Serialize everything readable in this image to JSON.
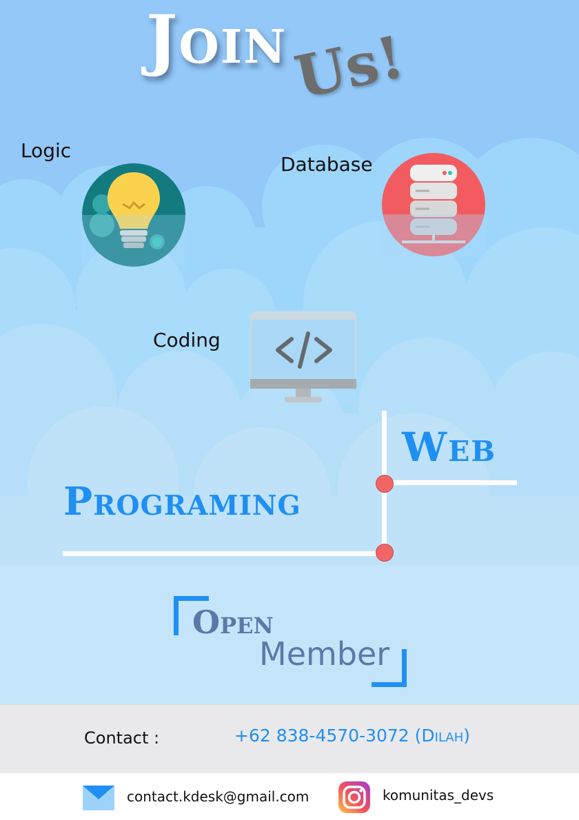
{
  "header": {
    "title_word1": "Join",
    "title_word2": "Us!"
  },
  "skills": {
    "logic": {
      "label": "Logic",
      "icon": "lightbulb-icon"
    },
    "database": {
      "label": "Database",
      "icon": "server-icon"
    },
    "coding": {
      "label": "Coding",
      "icon": "code-monitor-icon"
    }
  },
  "program": {
    "word1": "Web",
    "word2": "Programing"
  },
  "recruitment": {
    "open_word": "Open",
    "member_word": "Member"
  },
  "contact": {
    "label": "Contact :",
    "phone": "+62 838-4570-3072 (Dilah)"
  },
  "footer": {
    "email": "contact.kdesk@gmail.com",
    "email_icon": "mail-icon",
    "instagram": "komunitas_devs",
    "instagram_icon": "instagram-icon"
  },
  "colors": {
    "sky": "#93c8f8",
    "accent_blue": "#1f8ff2",
    "accent_red": "#f26567",
    "member_text": "#5b78a8"
  }
}
